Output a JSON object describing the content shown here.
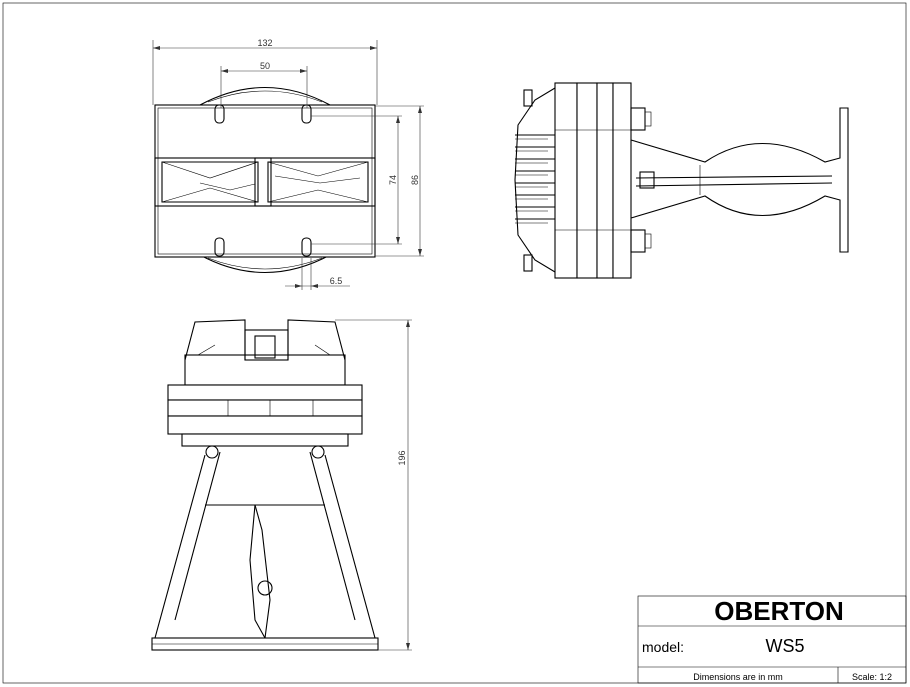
{
  "dimensions": {
    "width_overall": "132",
    "spacing_top": "50",
    "height_inner": "74",
    "height_outer": "86",
    "slot": "6.5",
    "height_total": "196"
  },
  "title_block": {
    "brand": "OBERTON",
    "model_label": "model:",
    "model_value": "WS5",
    "units_note": "Dimensions are in mm",
    "scale": "Scale: 1:2"
  }
}
